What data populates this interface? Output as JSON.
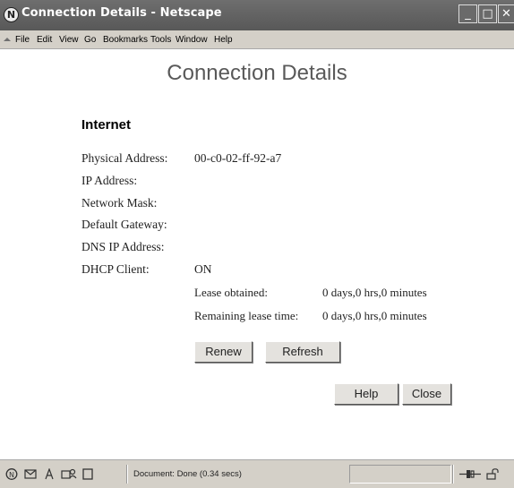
{
  "window": {
    "title": "Connection Details - Netscape",
    "controls": {
      "minimize": "_",
      "maximize": "□",
      "close": "✕"
    }
  },
  "menu": [
    "File",
    "Edit",
    "View",
    "Go",
    "Bookmarks",
    "Tools",
    "Window",
    "Help"
  ],
  "page": {
    "title": "Connection Details",
    "section": "Internet",
    "fields": [
      {
        "label": "Physical Address:",
        "value": "00-c0-02-ff-92-a7"
      },
      {
        "label": "IP Address:",
        "value": ""
      },
      {
        "label": "Network Mask:",
        "value": ""
      },
      {
        "label": "Default Gateway:",
        "value": ""
      },
      {
        "label": "DNS IP Address:",
        "value": ""
      },
      {
        "label": "DHCP Client:",
        "value": "ON"
      }
    ],
    "lease": [
      {
        "label": "Lease obtained:",
        "value": "0 days,0 hrs,0 minutes"
      },
      {
        "label": "Remaining lease time:",
        "value": "0 days,0 hrs,0 minutes"
      }
    ],
    "buttons": {
      "renew": "Renew",
      "refresh": "Refresh",
      "help": "Help",
      "close": "Close"
    }
  },
  "status": {
    "text": "Document: Done (0.34 secs)",
    "icons": [
      "netscape-icon",
      "mail-icon",
      "composer-icon",
      "address-book-icon",
      "page-icon",
      "connection-icon",
      "lock-icon"
    ]
  }
}
